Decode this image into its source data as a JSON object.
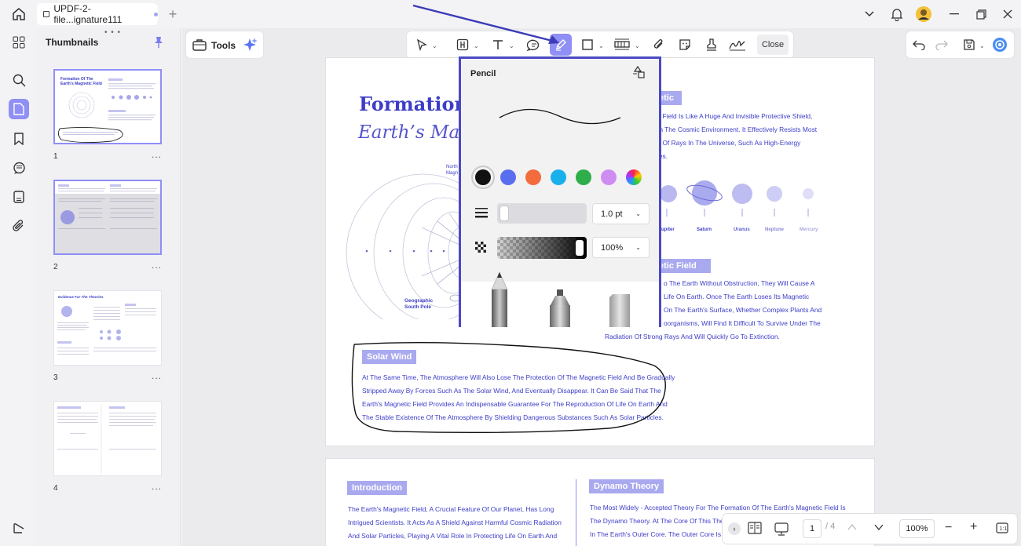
{
  "titlebar": {
    "tab_title": "UPDF-2-file...ignature111",
    "new_tab": "+"
  },
  "thumbnails": {
    "title": "Thumbnails",
    "pages": [
      {
        "number": "1",
        "more": "..."
      },
      {
        "number": "2",
        "more": "..."
      },
      {
        "number": "3",
        "more": "..."
      },
      {
        "number": "4",
        "more": "..."
      }
    ]
  },
  "toolbar": {
    "tools_label": "Tools",
    "close_label": "Close"
  },
  "pencil_panel": {
    "title": "Pencil",
    "colors": [
      "#111111",
      "#5a6ef0",
      "#f26c3e",
      "#19b0ec",
      "#2eae4a",
      "#cf8df2",
      "rainbow"
    ],
    "thickness": "1.0 pt",
    "opacity": "100%"
  },
  "page1": {
    "title_line1": "Formation O",
    "title_line2": "Earth’s Mag",
    "badge_magnetic": "etic",
    "right_para": [
      "c Field Is Like A Huge And Invisible Protective Shield,",
      "In The Cosmic Environment. It Effectively Resists Most",
      "s Of Rays In The Universe, Such As High-Energy",
      "les."
    ],
    "planet_labels": [
      "upiter",
      "Saturn",
      "Uranus",
      "Neptune",
      "Mercury"
    ],
    "badge_field": "etic Field",
    "field_para": [
      "o The Earth Without Obstruction, They Will Cause A",
      "Life On Earth. Once The Earth Loses Its Magnetic",
      "On The Earth's Surface, Whether Complex Plants And",
      "oorganisms, Will Find It Difficult To Survive Under The",
      "Radiation Of Strong Rays And Will Quickly Go To Extinction."
    ],
    "north_label": [
      "North",
      "Magn"
    ],
    "south_label": [
      "Geographic",
      "South Pole"
    ],
    "badge_solar": "Solar Wind",
    "solar_para": [
      "At The Same Time, The Atmosphere Will Also Lose The Protection Of The Magnetic Field And Be Gradually",
      "Stripped Away By Forces Such As The Solar Wind, And Eventually Disappear. It Can Be Said That The",
      "Earth's Magnetic Field Provides An Indispensable Guarantee For The Reproduction Of Life On Earth And",
      "The Stable Existence Of The Atmosphere By Shielding Dangerous Substances Such As Solar Particles."
    ]
  },
  "page2": {
    "badge_intro": "Introduction",
    "intro_para": [
      "The Earth's Magnetic Field, A Crucial Feature Of Our Planet, Has Long",
      "Intrigued Scientists. It Acts As A Shield Against Harmful Cosmic Radiation",
      "And Solar Particles, Playing A Vital Role In Protecting Life On Earth And"
    ],
    "badge_dynamo": "Dynamo Theory",
    "dynamo_para": [
      "The Most Widely - Accepted Theory For The Formation Of The Earth's Magnetic Field Is",
      "The Dynamo Theory. At The Core Of This Theor",
      "In The Earth's Outer Core. The Outer Core Is A"
    ]
  },
  "bottombar": {
    "page_current": "1",
    "page_total": "/ 4",
    "zoom": "100%"
  },
  "colors": {
    "accent": "#8f8ff5",
    "highlight_border": "#4a4ac4",
    "doc_text": "#3d3dc8",
    "badge": "#a9a9ef"
  }
}
